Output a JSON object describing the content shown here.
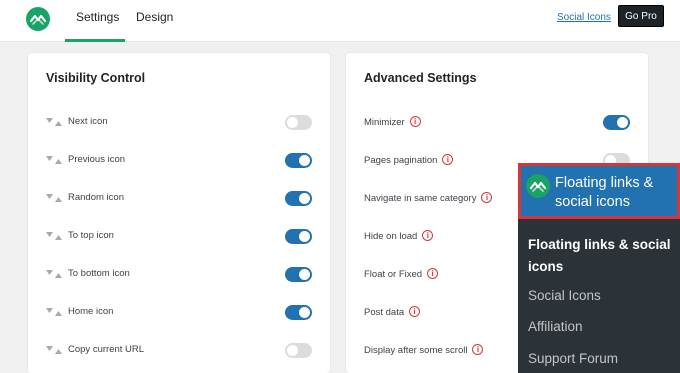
{
  "header": {
    "tabs": [
      {
        "label": "Settings",
        "active": true
      },
      {
        "label": "Design",
        "active": false
      }
    ],
    "social_icons_link": "Social Icons",
    "go_pro_label": "Go Pro",
    "accent_color": "#19a366"
  },
  "visibility": {
    "title": "Visibility Control",
    "items": [
      {
        "label": "Next icon",
        "enabled": false
      },
      {
        "label": "Previous icon",
        "enabled": true
      },
      {
        "label": "Random icon",
        "enabled": true
      },
      {
        "label": "To top icon",
        "enabled": true
      },
      {
        "label": "To bottom icon",
        "enabled": true
      },
      {
        "label": "Home icon",
        "enabled": true
      },
      {
        "label": "Copy current URL",
        "enabled": false
      }
    ]
  },
  "advanced": {
    "title": "Advanced Settings",
    "items": [
      {
        "label": "Minimizer",
        "enabled": true
      },
      {
        "label": "Pages pagination",
        "enabled": false
      },
      {
        "label": "Navigate in same category"
      },
      {
        "label": "Hide on load"
      },
      {
        "label": "Float or Fixed"
      },
      {
        "label": "Post data"
      },
      {
        "label": "Display after some scroll"
      }
    ]
  },
  "admin_menu": {
    "title": "Floating links & social icons",
    "submenu": [
      {
        "label": "Floating links & social icons",
        "active": true
      },
      {
        "label": "Social Icons",
        "active": false
      },
      {
        "label": "Affiliation",
        "active": false
      },
      {
        "label": "Support Forum",
        "active": false
      }
    ],
    "highlight_color": "#d63638"
  }
}
